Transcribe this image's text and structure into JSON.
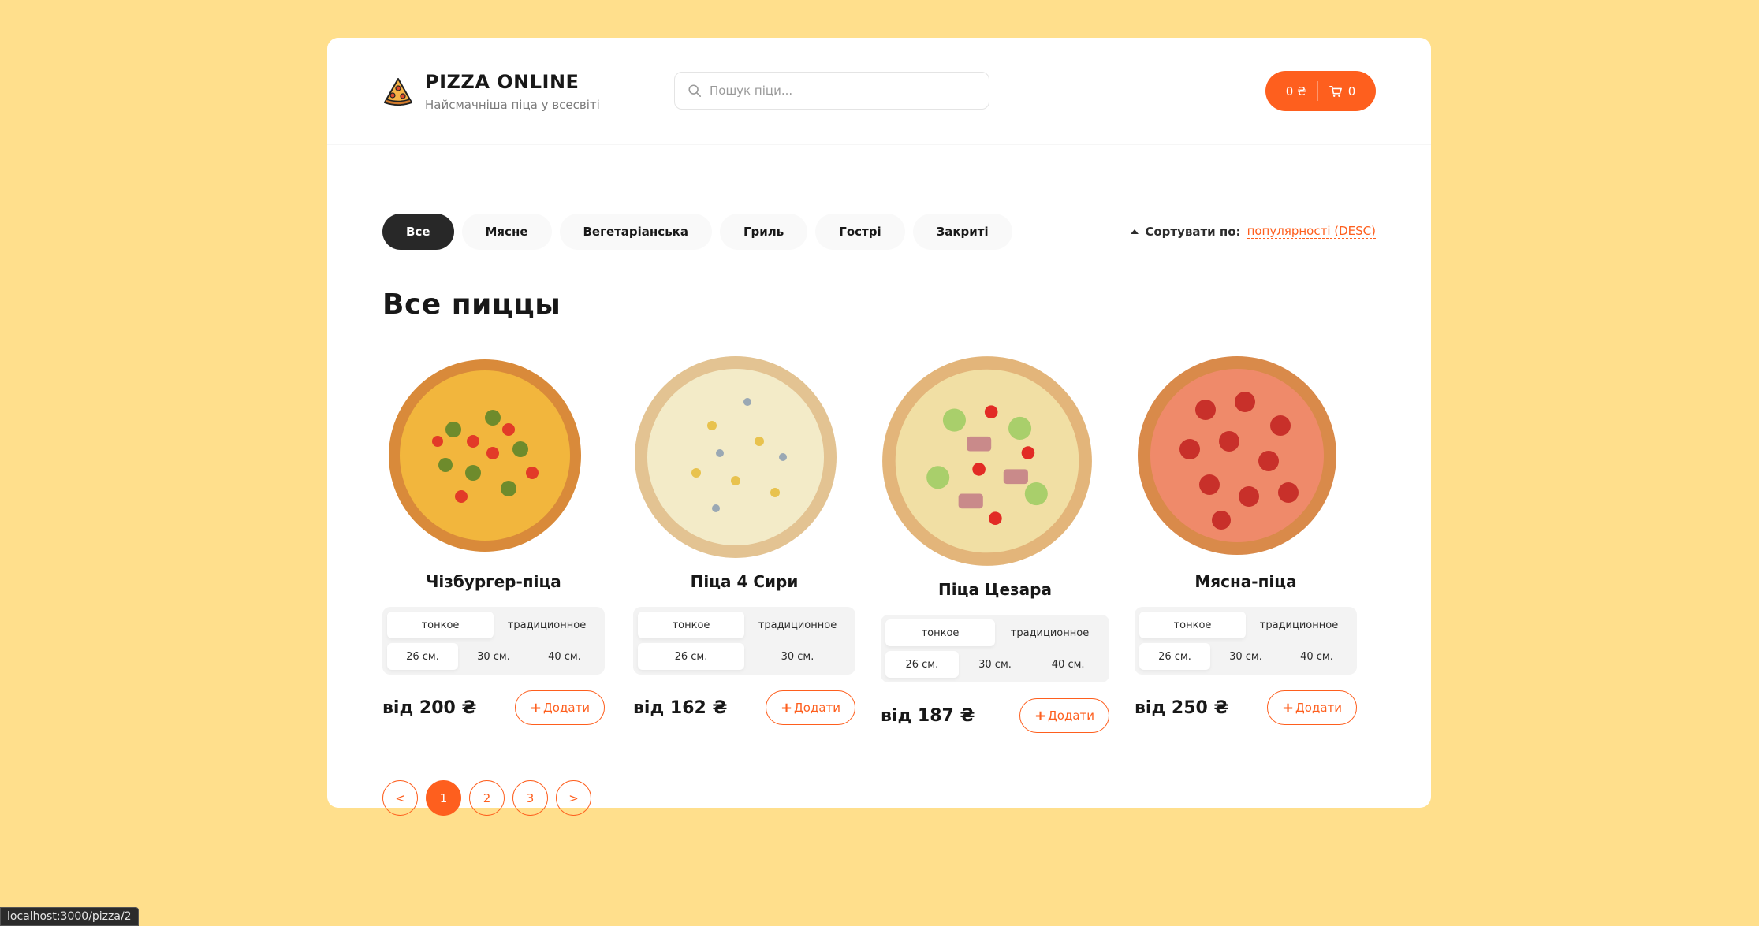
{
  "header": {
    "logo_icon": "pizza-slice-icon",
    "title": "PIZZA ONLINE",
    "subtitle": "Найсмачніша піца у всесвіті",
    "search_placeholder": "Пошук піци...",
    "search_value": "",
    "cart_price": "0 ₴",
    "cart_count": "0"
  },
  "categories": [
    "Все",
    "Мясне",
    "Вегетаріанська",
    "Гриль",
    "Гострі",
    "Закриті"
  ],
  "active_category": "Все",
  "sort": {
    "label": "Сортувати по:",
    "value": "популярності (DESC)"
  },
  "page_title": "Все пиццы",
  "pizzas": [
    {
      "name": "Чізбургер-піца",
      "types": [
        "тонкое",
        "традиционное"
      ],
      "sizes": [
        "26 см.",
        "30 см.",
        "40 см."
      ],
      "price": "від 200 ₴",
      "add_label": "Додати"
    },
    {
      "name": "Піца 4 Сири",
      "types": [
        "тонкое",
        "традиционное"
      ],
      "sizes": [
        "26 см.",
        "30 см."
      ],
      "price": "від 162 ₴",
      "add_label": "Додати"
    },
    {
      "name": "Піца Цезара",
      "types": [
        "тонкое",
        "традиционное"
      ],
      "sizes": [
        "26 см.",
        "30 см.",
        "40 см."
      ],
      "price": "від 187 ₴",
      "add_label": "Додати"
    },
    {
      "name": "Мясна-піца",
      "types": [
        "тонкое",
        "традиционное"
      ],
      "sizes": [
        "26 см.",
        "30 см.",
        "40 см."
      ],
      "price": "від 250 ₴",
      "add_label": "Додати"
    }
  ],
  "pagination": {
    "prev": "<",
    "pages": [
      "1",
      "2",
      "3"
    ],
    "next": ">",
    "current": "1"
  },
  "status_url": "localhost:3000/pizza/2",
  "colors": {
    "accent": "#fe5f1e",
    "background": "#ffdf8c",
    "dark": "#282828"
  }
}
